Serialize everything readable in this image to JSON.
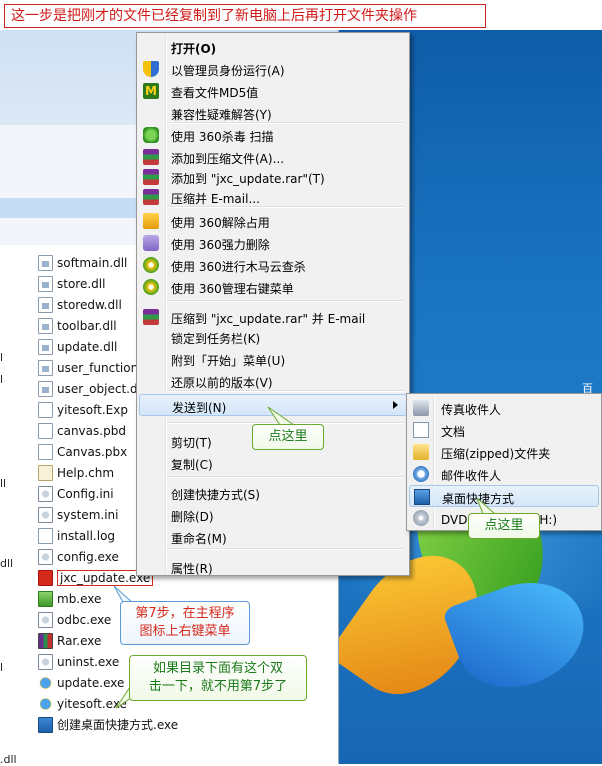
{
  "banner": {
    "text": "这一步是把刚才的文件已经复制到了新电脑上后再打开文件夹操作"
  },
  "desktop": {
    "right_text": "百会"
  },
  "explorer": {
    "left_fragments": [
      "l",
      "l",
      "ll",
      "dll",
      "l",
      ".dll"
    ],
    "files": [
      {
        "name": "softmain.dll",
        "icon": "dll"
      },
      {
        "name": "store.dll",
        "icon": "dll"
      },
      {
        "name": "storedw.dll",
        "icon": "dll"
      },
      {
        "name": "toolbar.dll",
        "icon": "dll"
      },
      {
        "name": "update.dll",
        "icon": "dll"
      },
      {
        "name": "user_function.",
        "icon": "dll"
      },
      {
        "name": "user_object.dl",
        "icon": "dll"
      },
      {
        "name": "yitesoft.Exp",
        "icon": "file"
      },
      {
        "name": "canvas.pbd",
        "icon": "file"
      },
      {
        "name": "Canvas.pbx",
        "icon": "file"
      },
      {
        "name": "Help.chm",
        "icon": "help"
      },
      {
        "name": "Config.ini",
        "icon": "cfg"
      },
      {
        "name": "system.ini",
        "icon": "cfg"
      },
      {
        "name": "install.log",
        "icon": "file"
      },
      {
        "name": "config.exe",
        "icon": "cfg"
      },
      {
        "name": "jxc_update.exe",
        "icon": "red"
      },
      {
        "name": "mb.exe",
        "icon": "green"
      },
      {
        "name": "odbc.exe",
        "icon": "cfg"
      },
      {
        "name": "Rar.exe",
        "icon": "rar"
      },
      {
        "name": "uninst.exe",
        "icon": "cfg"
      },
      {
        "name": "update.exe",
        "icon": "ie"
      },
      {
        "name": "yitesoft.exe",
        "icon": "ie"
      },
      {
        "name": "创建桌面快捷方式.exe",
        "icon": "desk"
      }
    ]
  },
  "context_menu": {
    "items": [
      {
        "label": "打开(O)",
        "icon": "",
        "bold": true
      },
      {
        "label": "以管理员身份运行(A)",
        "icon": "uac-shield-icon"
      },
      {
        "label": "查看文件MD5值",
        "icon": "md5-icon"
      },
      {
        "label": "兼容性疑难解答(Y)",
        "icon": ""
      },
      {
        "label": "使用 360杀毒 扫描",
        "icon": "360-shield-icon"
      },
      {
        "label": "添加到压缩文件(A)...",
        "icon": "winrar-icon"
      },
      {
        "label": "添加到 \"jxc_update.rar\"(T)",
        "icon": "winrar-icon"
      },
      {
        "label": "压缩并 E-mail...",
        "icon": "winrar-icon"
      },
      {
        "label": "使用 360解除占用",
        "icon": "360-unlock-icon"
      },
      {
        "label": "使用 360强力删除",
        "icon": "360-shred-icon"
      },
      {
        "label": "使用 360进行木马云查杀",
        "icon": "360-cloud-scan-icon"
      },
      {
        "label": "使用 360管理右键菜单",
        "icon": "360-menu-manager-icon"
      },
      {
        "label": "压缩到 \"jxc_update.rar\" 并 E-mail",
        "icon": "winrar-icon"
      },
      {
        "label": "锁定到任务栏(K)",
        "icon": ""
      },
      {
        "label": "附到「开始」菜单(U)",
        "icon": ""
      },
      {
        "label": "还原以前的版本(V)",
        "icon": ""
      },
      {
        "label": "发送到(N)",
        "icon": "",
        "active": true,
        "submenu": true
      },
      {
        "label": "剪切(T)",
        "icon": ""
      },
      {
        "label": "复制(C)",
        "icon": ""
      },
      {
        "label": "创建快捷方式(S)",
        "icon": ""
      },
      {
        "label": "删除(D)",
        "icon": ""
      },
      {
        "label": "重命名(M)",
        "icon": ""
      },
      {
        "label": "属性(R)",
        "icon": ""
      }
    ]
  },
  "send_to_menu": {
    "items": [
      {
        "label": "传真收件人",
        "icon": "fax-icon"
      },
      {
        "label": "文档",
        "icon": "document-icon"
      },
      {
        "label": "压缩(zipped)文件夹",
        "icon": "zip-folder-icon"
      },
      {
        "label": "邮件收件人",
        "icon": "mail-recipient-icon"
      },
      {
        "label": "桌面快捷方式",
        "icon": "desktop-shortcut-icon",
        "active": true
      },
      {
        "label": "DVD RW 驱动器 (H:)",
        "icon": "dvd-drive-icon"
      }
    ]
  },
  "callouts": {
    "click_here_1": "点这里",
    "click_here_2": "点这里",
    "step7": "第7步，在主程序图标上右键菜单",
    "step7_line1": "第7步，在主程序",
    "step7_line2": "图标上右键菜单",
    "tip_line1": "如果目录下面有这个双",
    "tip_line2": "击一下，就不用第7步了"
  },
  "colors": {
    "banner_red": "#d01818",
    "callout_green": "#1a7a1a",
    "desktop_blue": "#1a74c2"
  }
}
